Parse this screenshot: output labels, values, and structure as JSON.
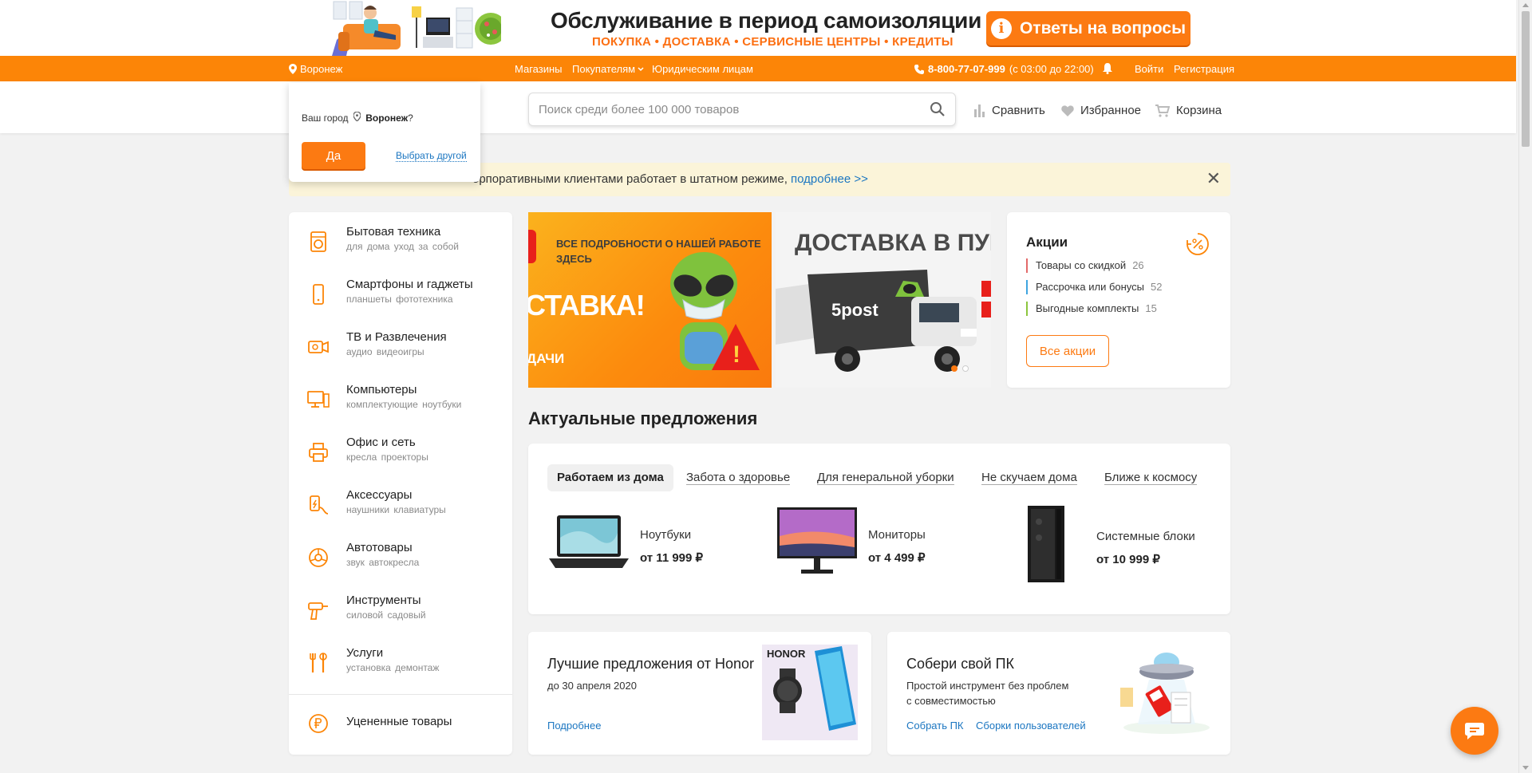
{
  "promo": {
    "title": "Обслуживание в период самоизоляции",
    "subtitle": "ПОКУПКА • ДОСТАВКА • СЕРВИСНЫЕ ЦЕНТРЫ • КРЕДИТЫ",
    "button_label": "Ответы на вопросы"
  },
  "topbar": {
    "city": "Воронеж",
    "links": [
      "Магазины",
      "Покупателям",
      "Юридическим лицам"
    ],
    "phone": "8-800-77-07-999",
    "hours": "(с 03:00 до 22:00)",
    "login": "Войти",
    "register": "Регистрация"
  },
  "header": {
    "search_placeholder": "Поиск среди более 100 000 товаров",
    "compare": "Сравнить",
    "favorites": "Избранное",
    "cart": "Корзина"
  },
  "city_popup": {
    "question_prefix": "Ваш город",
    "city": "Воронеж",
    "question_suffix": "?",
    "yes": "Да",
    "choose_other": "Выбрать другой"
  },
  "notice": {
    "text": "орпоративными клиентами работает в штатном режиме,",
    "link": "подробнее >>"
  },
  "categories": [
    {
      "name": "Бытовая техника",
      "sub": "для дома  уход за собой"
    },
    {
      "name": "Смартфоны и гаджеты",
      "sub": "планшеты  фототехника"
    },
    {
      "name": "ТВ и Развлечения",
      "sub": "аудио  видеоигры"
    },
    {
      "name": "Компьютеры",
      "sub": "комплектующие  ноутбуки"
    },
    {
      "name": "Офис и сеть",
      "sub": "кресла  проекторы"
    },
    {
      "name": "Аксессуары",
      "sub": "наушники  клавиатуры"
    },
    {
      "name": "Автотовары",
      "sub": "звук  автокресла"
    },
    {
      "name": "Инструменты",
      "sub": "силовой  садовый"
    },
    {
      "name": "Услуги",
      "sub": "установка  демонтаж"
    },
    {
      "name": "Уцененные товары",
      "sub": ""
    }
  ],
  "banner1": {
    "line1": "ВСЕ ПОДРОБНОСТИ О НАШЕЙ РАБОТЕ",
    "line2": "ЗДЕСЬ",
    "big": "СТАВКА!",
    "small": "ДАЧИ"
  },
  "banner2": {
    "title": "ДОСТАВКА В ПУН",
    "truck_logo": "5post"
  },
  "promotions": {
    "title": "Акции",
    "rows": [
      {
        "label": "Товары со скидкой",
        "count": "26",
        "color": "#e36a6a"
      },
      {
        "label": "Рассрочка или бонусы",
        "count": "52",
        "color": "#3fa5e0"
      },
      {
        "label": "Выгодные комплекты",
        "count": "15",
        "color": "#8cc63e"
      }
    ],
    "all_button": "Все акции"
  },
  "offers": {
    "title": "Актуальные предложения",
    "tabs": [
      "Работаем из дома",
      "Забота о здоровье",
      "Для генеральной уборки",
      "Не скучаем дома",
      "Ближе к космосу"
    ],
    "products": [
      {
        "name": "Ноутбуки",
        "price": "от 11 999 ₽"
      },
      {
        "name": "Мониторы",
        "price": "от 4 499 ₽"
      },
      {
        "name": "Системные блоки",
        "price": "от 10 999 ₽"
      }
    ]
  },
  "card_honor": {
    "title": "Лучшие предложения от Honor",
    "desc": "до 30 апреля 2020",
    "link": "Подробнее",
    "img_label": "HONOR"
  },
  "card_pc": {
    "title": "Собери свой ПК",
    "desc1": "Простой инструмент без проблем",
    "desc2": "с совместимостью",
    "link1": "Собрать ПК",
    "link2": "Сборки пользователей"
  },
  "colors": {
    "accent": "#fc8507",
    "button": "#fc7a12",
    "link": "#1b76c1",
    "notice_bg": "#fbf4d9"
  }
}
